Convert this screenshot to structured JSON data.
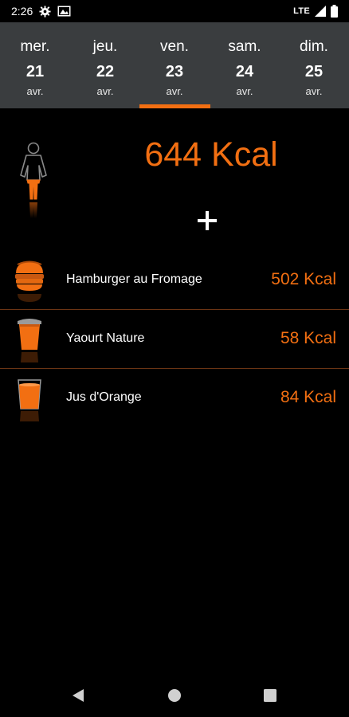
{
  "status_bar": {
    "time": "2:26",
    "network": "LTE",
    "icons": [
      "settings-icon",
      "image-icon",
      "signal-icon",
      "battery-icon"
    ]
  },
  "days": [
    {
      "name": "mer.",
      "num": "21",
      "month": "avr."
    },
    {
      "name": "jeu.",
      "num": "22",
      "month": "avr."
    },
    {
      "name": "ven.",
      "num": "23",
      "month": "avr."
    },
    {
      "name": "sam.",
      "num": "24",
      "month": "avr."
    },
    {
      "name": "dim.",
      "num": "25",
      "month": "avr."
    }
  ],
  "selected_day_index": 2,
  "summary": {
    "total_calories": "644 Kcal",
    "add_icon": "plus-icon",
    "person_icon": "woman-figure-icon",
    "person_fill_level": 0.45
  },
  "foods": [
    {
      "name": "Hamburger au Fromage",
      "calories": "502 Kcal",
      "icon": "burger-icon"
    },
    {
      "name": "Yaourt Nature",
      "calories": "58 Kcal",
      "icon": "yogurt-icon"
    },
    {
      "name": "Jus d'Orange",
      "calories": "84 Kcal",
      "icon": "juice-glass-icon"
    }
  ],
  "nav": {
    "icons": [
      "back-icon",
      "home-icon",
      "recents-icon"
    ]
  },
  "colors": {
    "accent": "#f26f12",
    "day_bar": "#3a3d3f",
    "background": "#000000"
  }
}
